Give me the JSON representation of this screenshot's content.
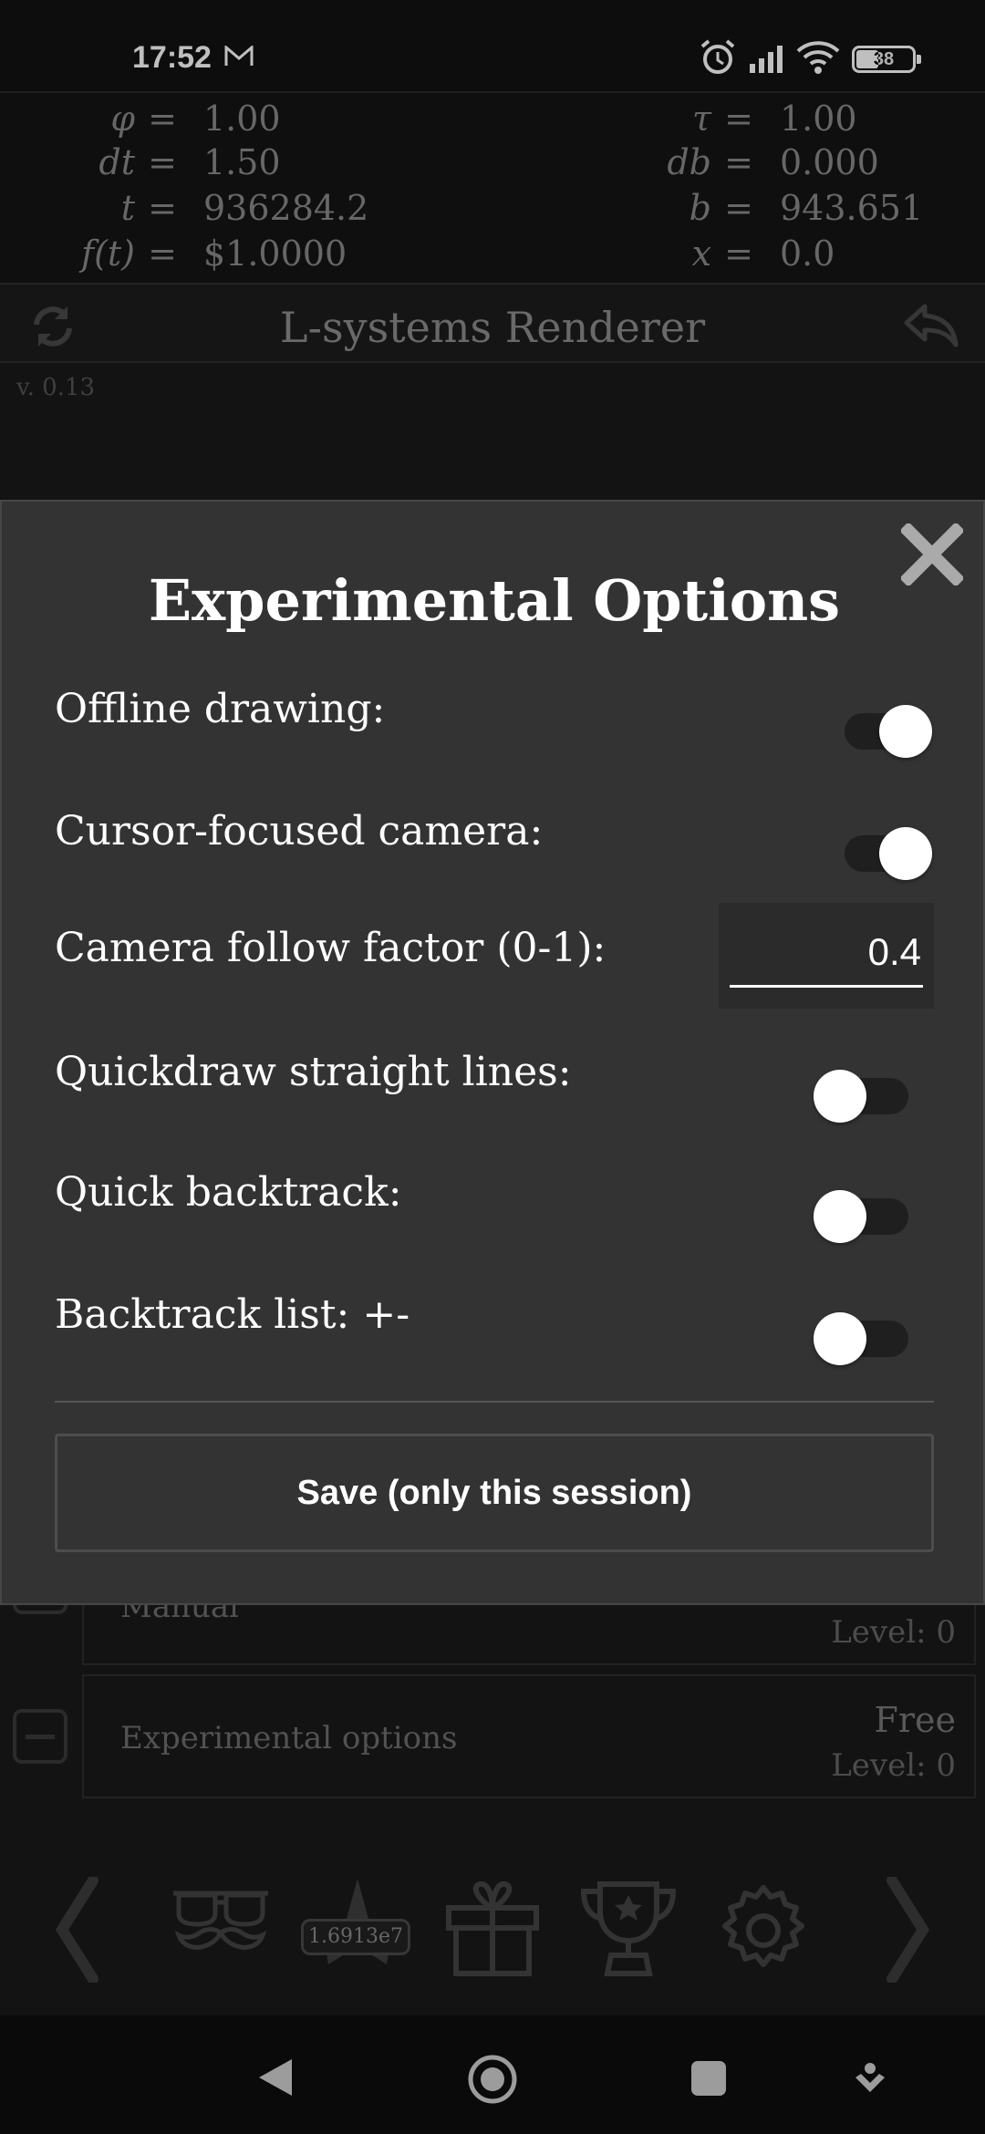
{
  "status_bar": {
    "time": "17:52",
    "battery": "38"
  },
  "variables": {
    "phi": {
      "symbol": "φ",
      "value": "1.00"
    },
    "dt": {
      "symbol": "dt",
      "value": "1.50"
    },
    "t": {
      "symbol": "t",
      "value": "936284.2"
    },
    "ft": {
      "symbol": "f(t)",
      "value": "$1.0000"
    },
    "tau": {
      "symbol": "τ",
      "value": "1.00"
    },
    "db": {
      "symbol": "db",
      "value": "0.000"
    },
    "b": {
      "symbol": "b",
      "value": "943.651"
    },
    "x": {
      "symbol": "x",
      "value": "0.0"
    },
    "equals": "="
  },
  "header": {
    "title": "L-systems Renderer",
    "version": "v. 0.13"
  },
  "background_list": [
    {
      "label": "Manual",
      "level": "Level: 0"
    },
    {
      "label": "Experimental options",
      "price": "Free",
      "level": "Level: 0"
    }
  ],
  "toolbar": {
    "score": "1.6913e7"
  },
  "modal": {
    "title": "Experimental Options",
    "options": [
      {
        "label": "Offline drawing:",
        "type": "toggle",
        "on": true
      },
      {
        "label": "Cursor-focused camera:",
        "type": "toggle",
        "on": true
      },
      {
        "label": "Camera follow factor (0-1):",
        "type": "number",
        "value": "0.4"
      },
      {
        "label": "Quickdraw straight lines:",
        "type": "toggle",
        "on": false
      },
      {
        "label": "Quick backtrack:",
        "type": "toggle",
        "on": false
      },
      {
        "label": "Backtrack list: +-",
        "type": "toggle",
        "on": false
      }
    ],
    "save_label": "Save (only this session)"
  },
  "icons": [
    "mail-icon",
    "alarm-icon",
    "signal-icon",
    "wifi-icon",
    "battery-icon",
    "refresh-icon",
    "undo-icon",
    "close-icon",
    "chevron-left-icon",
    "disguise-icon",
    "star-icon",
    "gift-icon",
    "trophy-icon",
    "gear-icon",
    "chevron-right-icon",
    "nav-back-icon",
    "nav-home-icon",
    "nav-recents-icon",
    "nav-assist-icon"
  ],
  "colors": {
    "modal_bg": "#333333",
    "app_bg": "#1a1a1a",
    "text_primary": "#ffffff",
    "text_dim": "#888888"
  }
}
